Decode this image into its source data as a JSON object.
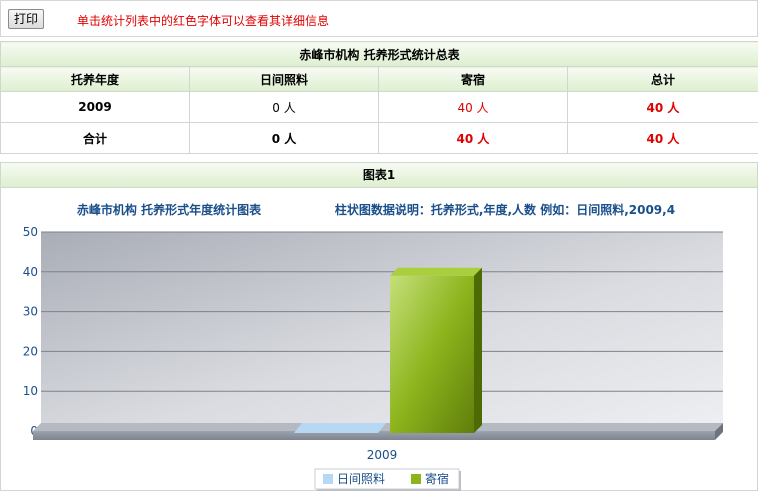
{
  "toolbar": {
    "print_label": "打印",
    "hint": "单击统计列表中的红色字体可以查看其详细信息"
  },
  "summary": {
    "title": "赤峰市机构  托养形式统计总表",
    "headers": [
      "托养年度",
      "日间照料",
      "寄宿",
      "总计"
    ],
    "rows": [
      [
        "2009",
        "0 人",
        "40 人",
        "40 人"
      ],
      [
        "合计",
        "0 人",
        "40 人",
        "40 人"
      ]
    ]
  },
  "chart_panel": {
    "header": "图表1"
  },
  "chart_data": {
    "type": "bar",
    "title": "赤峰市机构 托养形式年度统计图表",
    "subtitle": "柱状图数据说明：托养形式,年度,人数  例如：日间照料,2009,4",
    "categories": [
      "2009"
    ],
    "series": [
      {
        "name": "日间照料",
        "values": [
          0
        ],
        "color": "#b7d8f3"
      },
      {
        "name": "寄宿",
        "values": [
          40
        ],
        "color": "#8db41c"
      }
    ],
    "yticks": [
      "0",
      "10",
      "20",
      "30",
      "40",
      "50"
    ],
    "ylim": [
      0,
      50
    ],
    "legend_position": "bottom",
    "grid": true
  }
}
